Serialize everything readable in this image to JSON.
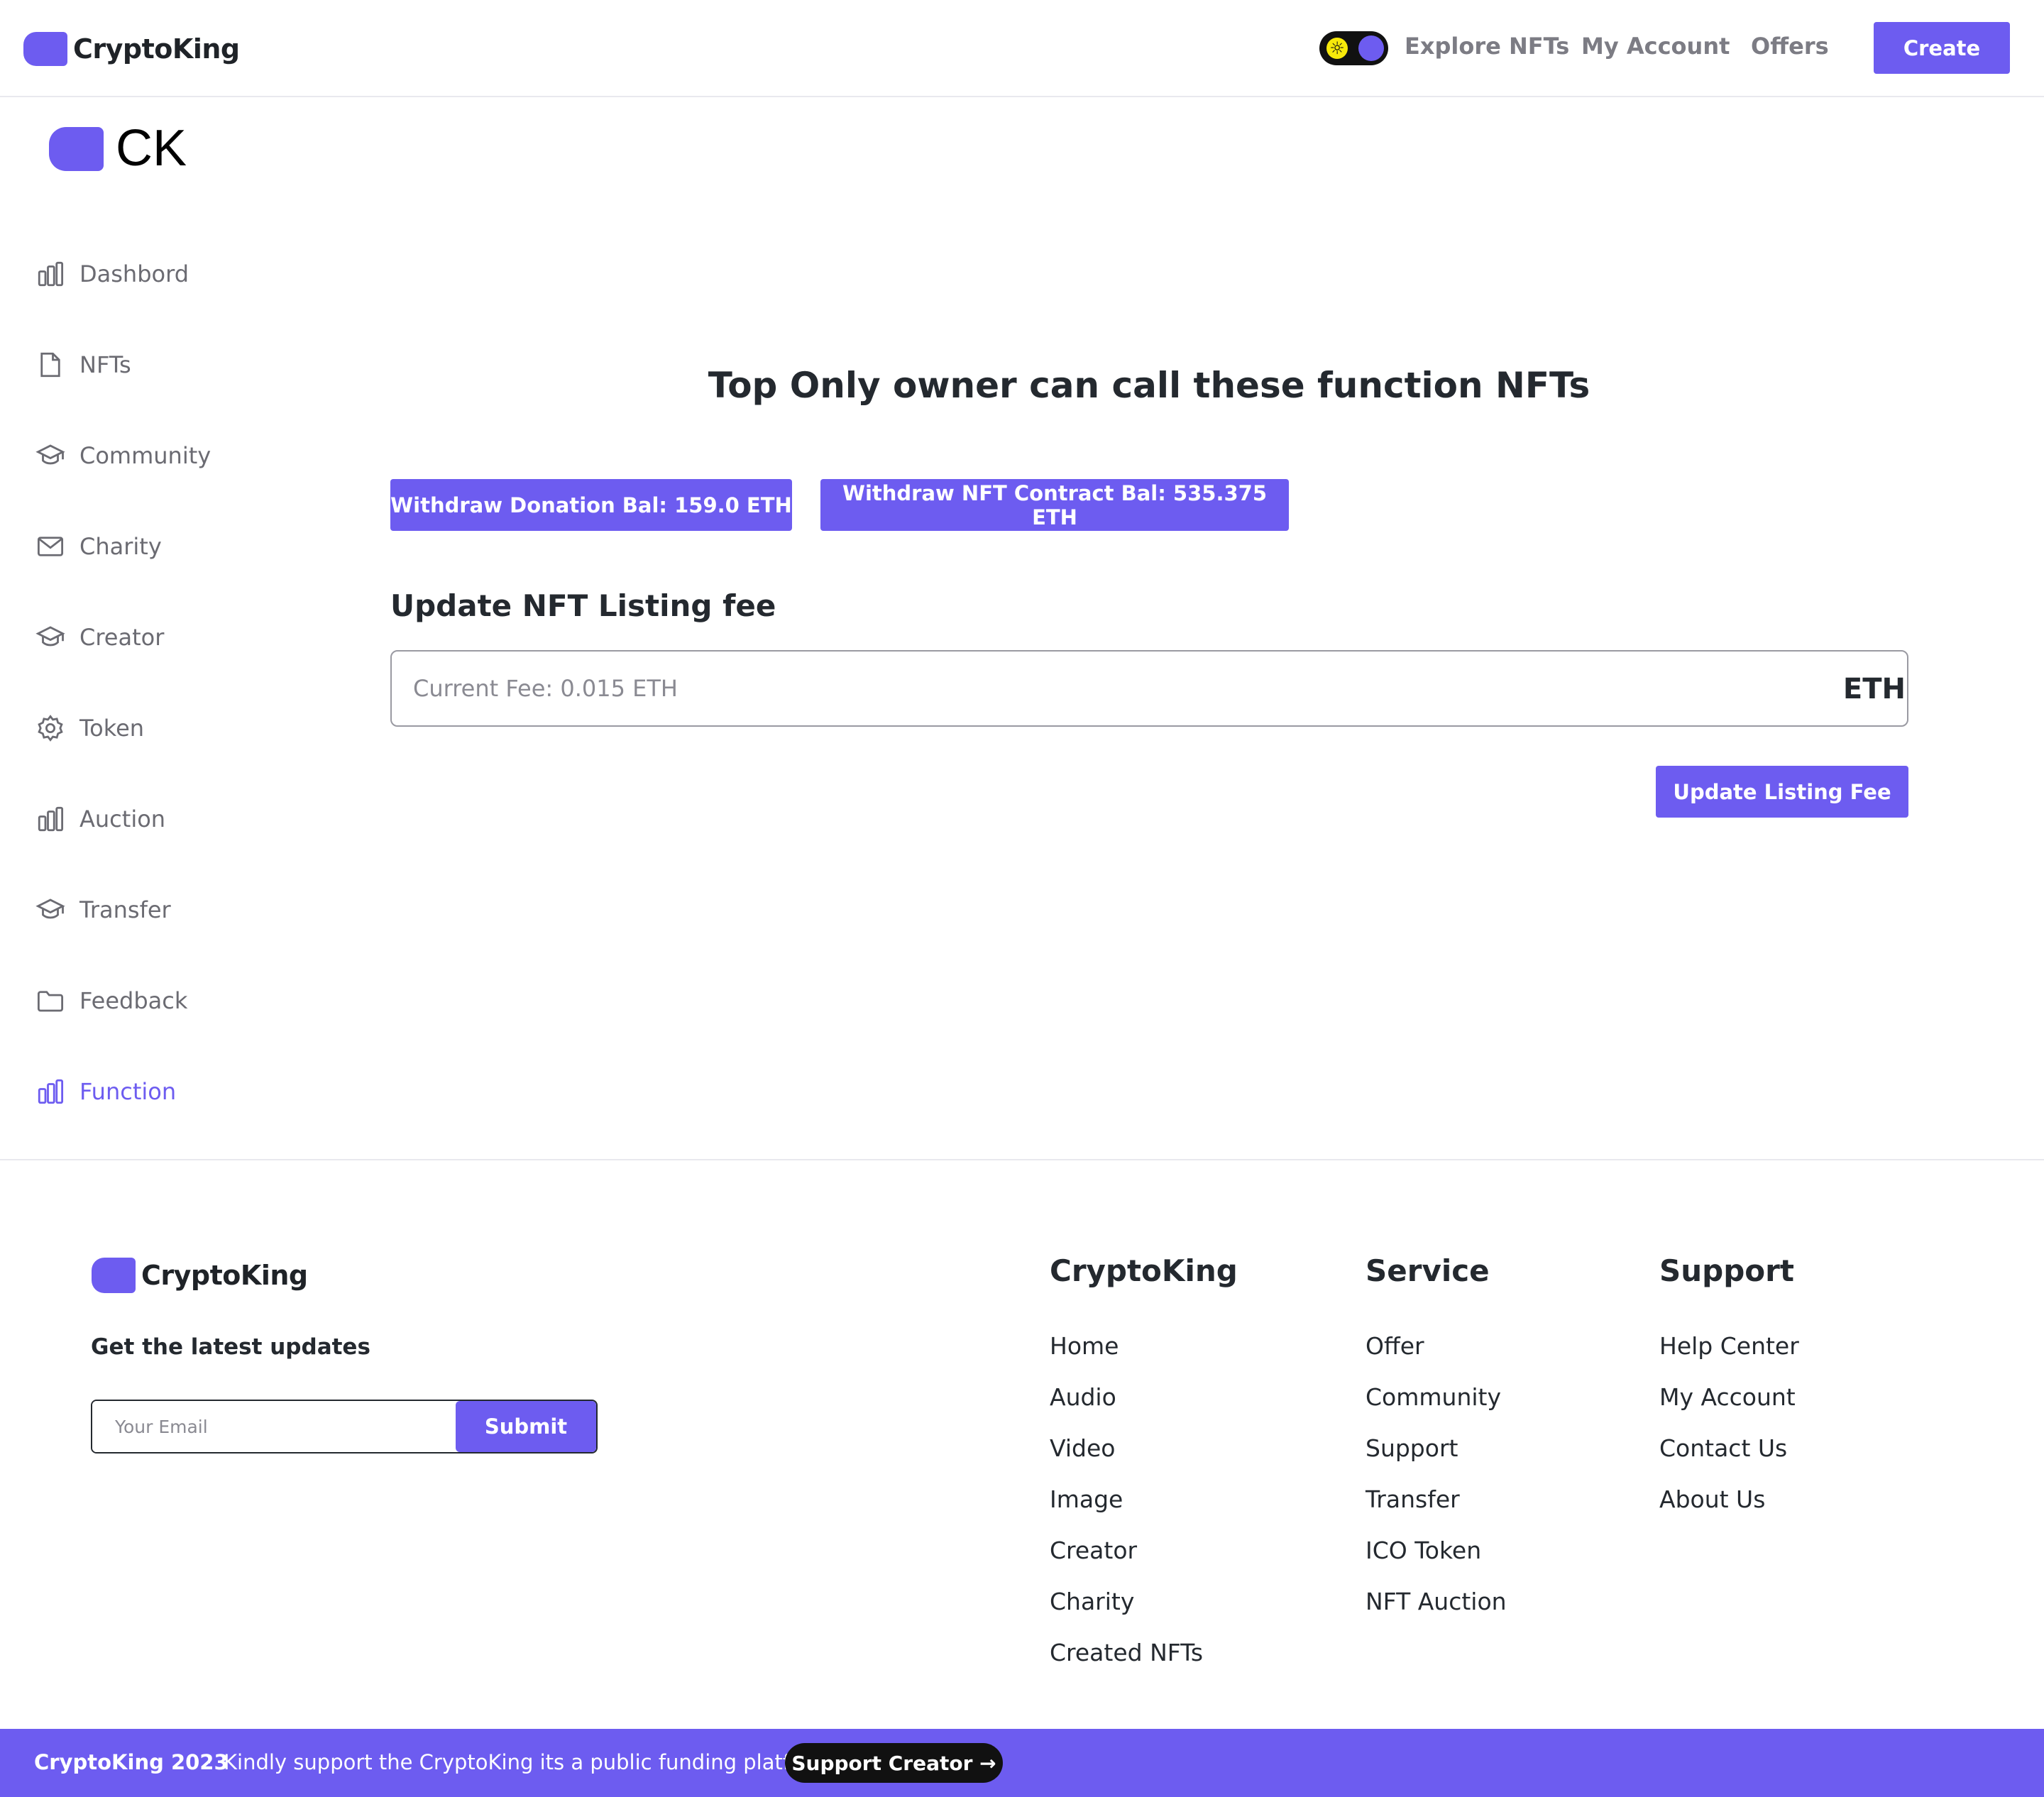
{
  "header": {
    "brand": "CryptoKing",
    "nav": {
      "explore": "Explore NFTs",
      "account": "My Account",
      "offers": "Offers"
    },
    "create_label": "Create",
    "toggle_icon": "sun-icon"
  },
  "sidebar": {
    "logo_text": "CK",
    "items": [
      {
        "label": "Dashbord",
        "icon": "bar-chart-icon"
      },
      {
        "label": "NFTs",
        "icon": "file-icon"
      },
      {
        "label": "Community",
        "icon": "graduation-cap-icon"
      },
      {
        "label": "Charity",
        "icon": "mail-icon"
      },
      {
        "label": "Creator",
        "icon": "graduation-cap-icon"
      },
      {
        "label": "Token",
        "icon": "gear-icon"
      },
      {
        "label": "Auction",
        "icon": "bar-chart-icon"
      },
      {
        "label": "Transfer",
        "icon": "graduation-cap-icon"
      },
      {
        "label": "Feedback",
        "icon": "folder-icon"
      },
      {
        "label": "Function",
        "icon": "bar-chart-icon",
        "active": true
      }
    ]
  },
  "main": {
    "title": "Top Only owner can call these function NFTs",
    "withdraw_donation": "Withdraw Donation Bal: 159.0 ETH",
    "withdraw_contract": "Withdraw NFT Contract Bal: 535.375 ETH",
    "section_title": "Update NFT Listing fee",
    "fee_placeholder": "Current Fee: 0.015 ETH",
    "fee_value": "",
    "fee_unit": "ETH",
    "update_button": "Update Listing Fee"
  },
  "footer": {
    "brand": "CryptoKing",
    "updates_title": "Get the latest updates",
    "email_placeholder": "Your Email",
    "submit_label": "Submit",
    "columns": [
      {
        "title": "CryptoKing",
        "links": [
          "Home",
          "Audio",
          "Video",
          "Image",
          "Creator",
          "Charity",
          "Created NFTs"
        ]
      },
      {
        "title": "Service",
        "links": [
          "Offer",
          "Community",
          "Support",
          "Transfer",
          "ICO Token",
          "NFT Auction"
        ]
      },
      {
        "title": "Support",
        "links": [
          "Help Center",
          "My Account",
          "Contact Us",
          "About Us"
        ]
      }
    ]
  },
  "bottom_bar": {
    "copyright": "CryptoKing 2023",
    "separator": "·",
    "message": "Kindly support the CryptoKing its a public funding platform",
    "support_button": "Support Creator →"
  },
  "colors": {
    "accent": "#6d5cf0",
    "text": "#24292f",
    "muted": "#6b6b72",
    "toggle_sun": "#f7e90a"
  }
}
